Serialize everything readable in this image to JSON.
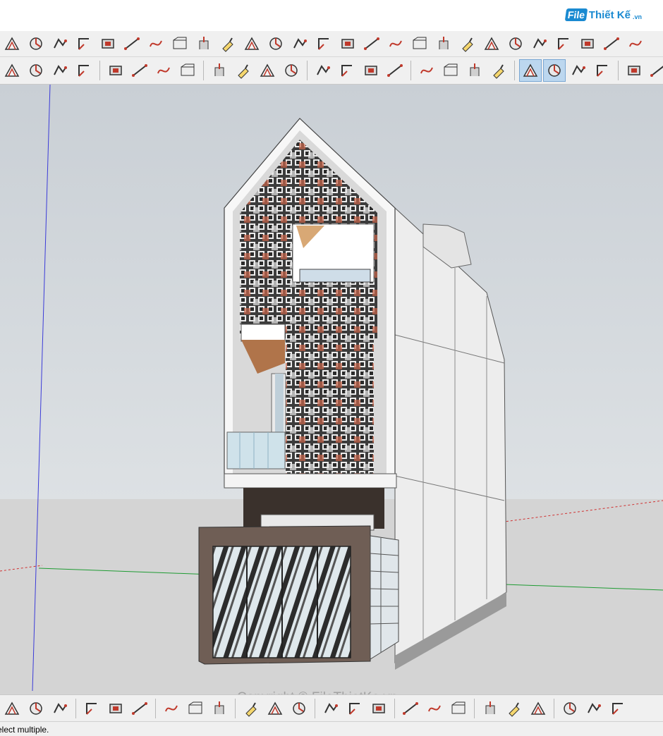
{
  "brand": {
    "logo_file": "File",
    "logo_thietke": "Thiết Kế",
    "logo_domain": ".vn"
  },
  "watermark": "Copyright © FileThietKe.vn",
  "status": {
    "text": "elect multiple."
  },
  "colors": {
    "sky": "#cdd3d8",
    "ground": "#d4d4d4",
    "axis_blue": "#3b3bd8",
    "axis_green": "#1e9b32",
    "axis_red": "#d03030",
    "active_tool": "#bcd7ef"
  },
  "toolbar_row1": [
    "dimension-icon",
    "protractor-icon",
    "follow-me-icon",
    "axes-icon",
    "offset-icon",
    "line-icon",
    "freehand-icon",
    "section-icon",
    "push-pull-icon",
    "paint-icon",
    "stairs-icon",
    "railing-icon",
    "dome-icon",
    "spiral-icon",
    "wall-icon",
    "shell-icon",
    "louver-icon",
    "screw-icon",
    "arrow-down-icon",
    "trim-icon",
    "split-icon",
    "stack-icon",
    "window-icon",
    "extrude-icon",
    "array-icon",
    "grid-icon",
    "hatch-icon"
  ],
  "toolbar_row2": [
    "section-plane-icon",
    "tape-measure-icon",
    "text-label-icon",
    "paint-bucket-icon",
    "orbit-icon",
    "pan-icon",
    "zoom-icon",
    "zoom-extents-icon",
    "warehouse-icon",
    "extension-warehouse-icon",
    "share-model-icon",
    "ruby-icon",
    "arc-3d-icon",
    "iso-view-icon",
    "right-view-icon",
    "top-view-icon",
    "front-view-icon",
    "back-view-icon",
    "left-view-icon",
    "xray-icon",
    "wireframe-icon",
    "hidden-line-icon",
    "shaded-icon",
    "textured-icon",
    "group-icon",
    "component-icon"
  ],
  "toolbar_active": [
    "wireframe-icon",
    "hidden-line-icon"
  ],
  "bottom_toolbar": [
    "text-tool-icon",
    "axis-tool-icon",
    "help-icon",
    "box-icon",
    "prism-icon",
    "pyramid-icon",
    "cone-icon",
    "cylinder-icon",
    "sphere-icon",
    "tube-icon",
    "torus-icon",
    "lathe-icon",
    "helix-icon",
    "geodesic-icon",
    "dodeca-icon",
    "magnet-icon",
    "tools-icon",
    "curve-icon",
    "bezier-icon",
    "pen-icon",
    "arc-curve-icon",
    "spiral-tool-icon",
    "globe-icon",
    "dial-icon"
  ]
}
